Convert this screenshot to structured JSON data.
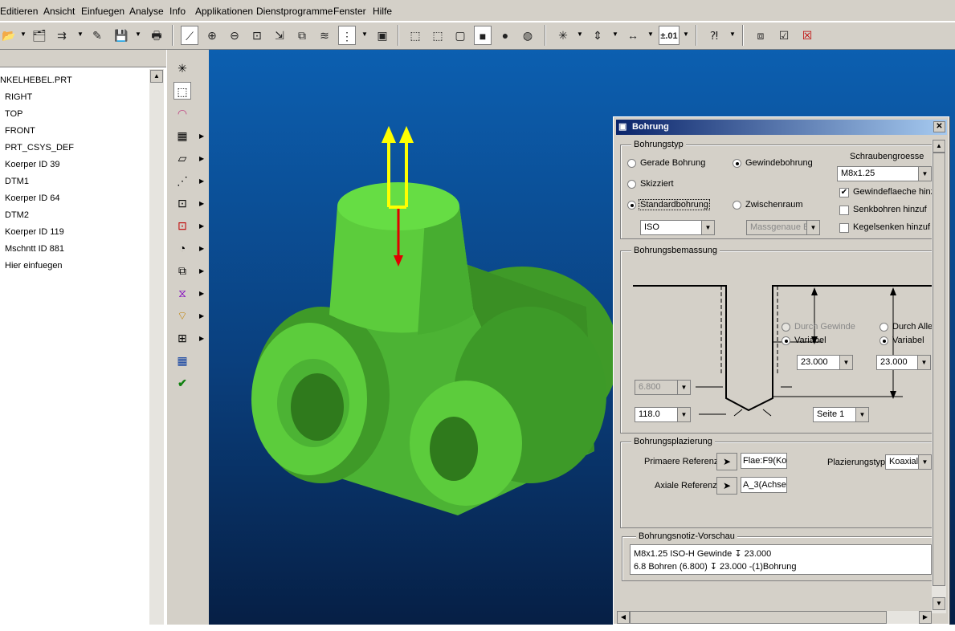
{
  "menu": [
    "Editieren",
    "Ansicht",
    "Einfuegen",
    "Analyse",
    "Info",
    "Applikationen",
    "Dienstprogramme",
    "Fenster",
    "Hilfe"
  ],
  "toolbar": {
    "tolerance_label": "±.01"
  },
  "tree": {
    "items": [
      "NKELHEBEL.PRT",
      "RIGHT",
      "TOP",
      "FRONT",
      "PRT_CSYS_DEF",
      "Koerper ID 39",
      "DTM1",
      "Koerper ID 64",
      "DTM2",
      "Koerper ID 119",
      "Mschntt ID 881",
      "Hier einfuegen"
    ]
  },
  "dialog": {
    "title": "Bohrung",
    "bohrungstyp": {
      "label": "Bohrungstyp",
      "gerade": "Gerade Bohrung",
      "gewinde": "Gewindebohrung",
      "skizziert": "Skizziert",
      "standard": "Standardbohrung",
      "zwischenraum": "Zwischenraum",
      "norm": "ISO",
      "massgenaue": "Massgenaue E",
      "schraubengroesse_label": "Schraubengroesse",
      "schraubengroesse": "M8x1.25",
      "gewindeflaeche": "Gewindeflaeche hinz",
      "senkbohren": "Senkbohren hinzuf",
      "kegelsenken": "Kegelsenken hinzuf"
    },
    "bemassung": {
      "label": "Bohrungsbemassung",
      "durch_gewinde": "Durch Gewinde",
      "variabel1": "Variabel",
      "durch_alle": "Durch Alle",
      "variabel2": "Variabel",
      "depth1": "23.000",
      "depth2": "23.000",
      "diameter": "6.800",
      "angle": "118.0",
      "side": "Seite 1"
    },
    "platzierung": {
      "label": "Bohrungsplazierung",
      "primaer_label": "Primaere Referenz",
      "primaer_value": "Flae:F9(Ko",
      "axial_label": "Axiale Referenz",
      "axial_value": "A_3(Achse",
      "typ_label": "Plazierungstyp",
      "typ_value": "Koaxial"
    },
    "notiz": {
      "label": "Bohrungsnotiz-Vorschau",
      "line1": "M8x1.25 ISO-H Gewinde ↧ 23.000",
      "line2": "6.8 Bohren (6.800) ↧ 23.000 -(1)Bohrung"
    }
  },
  "colors": {
    "model_green": "#5ccc3c",
    "viewport_top": "#0c5fb0",
    "viewport_bottom": "#061f45"
  }
}
